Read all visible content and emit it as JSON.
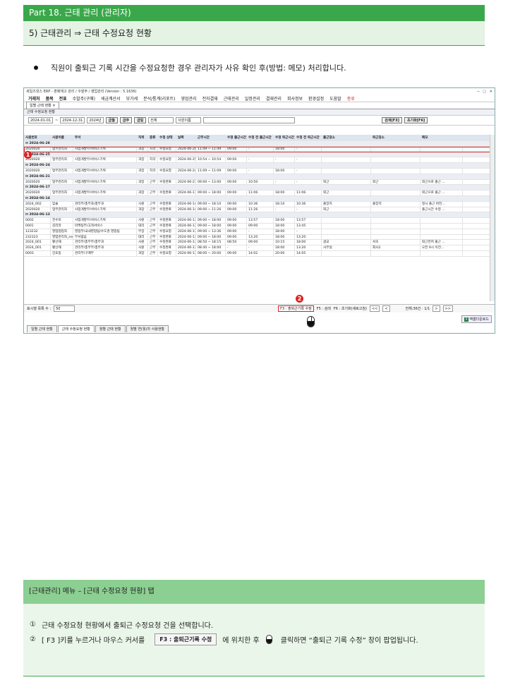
{
  "section": {
    "part": "Part 18. 근태 관리 (관리자)",
    "subsection": "5) 근태관리 ⇒ 근태 수정요청 현황"
  },
  "intro": "직원이 출퇴근 기록 시간을 수정요청한 경우 관리자가 사유  확인 후(방법: 메모) 처리합니다.",
  "app": {
    "title": "세일즈넷스 ERP - 판매재고 관리 / 수발주 / 영업관리 (Version : 5.1636)",
    "menu": [
      "거래처",
      "품목",
      "전표",
      "수발주(구매)",
      "세금계산서",
      "부가세",
      "분석/통계(리포트)",
      "영업관리",
      "전자결재",
      "근태관리",
      "일정관리",
      "결재관리",
      "회사정보",
      "환경설정",
      "도움말",
      "종료"
    ],
    "tab": "일별 근태 현황",
    "subtitle": "근태 수정요청 현황",
    "filters": {
      "from": "2024-01-01",
      "to": "2024-12-31",
      "year": "2024년",
      "btn1": "금월",
      "btn2": "금주",
      "btn3": "금일",
      "type": "전체",
      "emp": "사원이름",
      "search": "검색[F3]",
      "reset": "초기화[F6]"
    },
    "columns": [
      "사원번호",
      "사원이름",
      "부서",
      "직위",
      "종류",
      "수정 상태",
      "날짜",
      "근무시간",
      "수정 출근시간",
      "수정 전 출근시간",
      "수정 퇴근시간",
      "수정 전 퇴근시간",
      "출근장소",
      "퇴근장소",
      "메모"
    ],
    "rows": [
      {
        "g": "2024-06-28"
      },
      {
        "c": [
          "2020020",
          "업무관리자",
          "사업개발부/서비스기획",
          "과장",
          "지각",
          "수정요청",
          "2024-06-28",
          "11:49 ~ 11:49",
          "09:00",
          "-",
          "18:00",
          "-",
          "",
          "",
          ""
        ],
        "sel": true
      },
      {
        "g": "2024-06-25"
      },
      {
        "c": [
          "2020020",
          "업무관리자",
          "사업개발부/서비스기획",
          "과장",
          "지각",
          "수정요청",
          "2024-06-25",
          "10:54 ~ 10:54",
          "09:00",
          "-",
          "-",
          "-",
          "",
          "",
          ""
        ]
      },
      {
        "g": "2024-06-24"
      },
      {
        "c": [
          "2020020",
          "업무관리자",
          "사업개발부/서비스기획",
          "과장",
          "지각",
          "수정요청",
          "2024-06-24",
          "11:09 ~ 11:09",
          "09:00",
          "-",
          "18:00",
          "-",
          "",
          "",
          ""
        ]
      },
      {
        "g": "2024-06-21"
      },
      {
        "c": [
          "2020020",
          "업무관리자",
          "사업개발부/서비스기획",
          "과장",
          "근무",
          "수정완료",
          "2024-06-21",
          "09:00 ~ 13:00",
          "09:00",
          "10:50",
          "-",
          "-",
          "외근",
          "외근",
          "외근으로 출근 …"
        ]
      },
      {
        "g": "2024-06-17"
      },
      {
        "c": [
          "2020020",
          "업무관리자",
          "사업개발부/서비스기획",
          "과장",
          "근무",
          "수정완료",
          "2024-06-17",
          "09:00 ~ 18:00",
          "09:00",
          "11:06",
          "18:00",
          "11:06",
          "외근",
          "",
          "외근으로 출근 …"
        ]
      },
      {
        "g": "2024-06-14"
      },
      {
        "c": [
          "2024_002",
          "임솔",
          "관리부/총무과/총무과",
          "사원",
          "근무",
          "수정완료",
          "2024-06-14",
          "09:00 ~ 18:10",
          "09:00",
          "10:36",
          "18:10",
          "10:36",
          "출장지",
          "출장지",
          "정시 출근 버전…"
        ]
      },
      {
        "c": [
          "2020020",
          "업무관리자",
          "사업개발부/서비스기획",
          "과장",
          "근무",
          "수정완료",
          "2024-06-14",
          "09:00 ~ 11:26",
          "09:00",
          "11:26",
          "-",
          "-",
          "외근",
          "",
          "출근시간 수정 …"
        ]
      },
      {
        "g": "2024-06-13"
      },
      {
        "c": [
          "0002",
          "전수미",
          "사업개발부/서비스기획",
          "사원",
          "근무",
          "수정완료",
          "2024-06-13",
          "09:00 ~ 18:00",
          "09:00",
          "13:57",
          "18:00",
          "13:57",
          "",
          "",
          ""
        ]
      },
      {
        "c": [
          "0001",
          "김리라",
          "마케팅부/고객서비스",
          "대리",
          "근무",
          "수정완료",
          "2024-06-13",
          "09:00 ~ 18:00",
          "09:00",
          "09:00",
          "18:00",
          "13:45",
          "",
          "",
          ""
        ]
      },
      {
        "c": [
          "123232",
          "영업업업자",
          "영업부/국내영업팀/수도권 영업팀",
          "부장",
          "근무",
          "수정요청",
          "2024-06-13",
          "09:00 ~ 13:36",
          "09:00",
          "-",
          "18:00",
          "-",
          "",
          "",
          ""
        ]
      },
      {
        "c": [
          "232323",
          "영업관리자_new",
          "부서없음",
          "대리",
          "근무",
          "수정완료",
          "2024-06-13",
          "09:00 ~ 18:00",
          "09:00",
          "13:20",
          "18:00",
          "13:20",
          "",
          "",
          ""
        ]
      },
      {
        "c": [
          "2024_001",
          "황선재",
          "관리부/총무부/총무과",
          "사원",
          "근무",
          "수정완료",
          "2024-06-13",
          "08:50 ~ 18:15",
          "08:50",
          "09:00",
          "10:15",
          "18:00",
          "광교",
          "서초",
          "퇴근먼저 출근 …"
        ]
      },
      {
        "c": [
          "2024_001",
          "황선재",
          "관리부/총무부/총무과",
          "사원",
          "근무",
          "수정완료",
          "2024-06-13",
          "08:40 ~ 18:00",
          "-",
          "-",
          "18:00",
          "13:20",
          "사무실",
          "회사2",
          "오전 9시 이전…"
        ]
      },
      {
        "c": [
          "0003",
          "강효동",
          "관리부/구매부",
          "과장",
          "근무",
          "수정요청",
          "2024-06-13",
          "08:00 ~ 20:00",
          "09:00",
          "14:02",
          "20:00",
          "14:05",
          "",
          "",
          ""
        ]
      }
    ],
    "footer": {
      "count_label": "표시행 목록 수 :",
      "count": "50",
      "f3": "F3 : 출퇴근기록 수정",
      "f5": "F5 : 검색",
      "f6": "F6 : 초기화(새로고침)",
      "total": "전체:36건 : 1/1"
    },
    "excel": "엑셀다운로드",
    "bottom_tabs": [
      "일별 근태 현황",
      "근태 수정요청 현황",
      "월별 근태 현황",
      "월별 연(월)차 사용현황"
    ]
  },
  "badges": [
    "1",
    "2"
  ],
  "bottom": {
    "title": "[근태관리] 메뉴 – [근태 수정요청 현황] 탭",
    "step1_num": "①",
    "step1": "근태 수정요청 현황에서 출퇴근 수정요청 건을 선택합니다.",
    "step2_num": "②",
    "step2a": "[ F3 ]키를 누르거나 마우스 커서를",
    "step2_key": "F3 : 출퇴근기록 수정",
    "step2b": "에 위치한 후",
    "step2c": "클릭하면 “출퇴근 기록 수정” 창이 팝업됩니다."
  }
}
